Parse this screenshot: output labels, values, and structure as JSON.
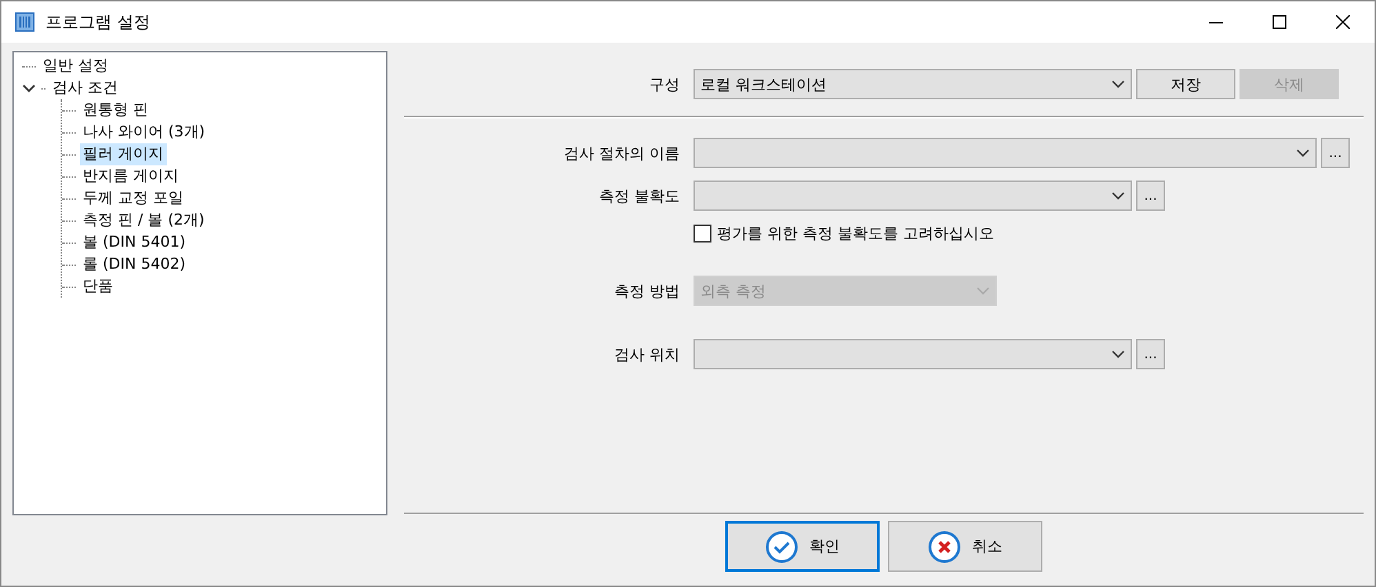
{
  "window": {
    "title": "프로그램 설정"
  },
  "tree": [
    {
      "label": "일반 설정",
      "selected": false
    },
    {
      "label": "검사 조건",
      "selected": false,
      "expanded": true,
      "children": [
        {
          "label": "원통형 핀",
          "selected": false
        },
        {
          "label": "나사 와이어 (3개)",
          "selected": false
        },
        {
          "label": "필러 게이지",
          "selected": true
        },
        {
          "label": "반지름 게이지",
          "selected": false
        },
        {
          "label": "두께 교정 포일",
          "selected": false
        },
        {
          "label": "측정 핀 / 볼 (2개)",
          "selected": false
        },
        {
          "label": "볼 (DIN 5401)",
          "selected": false
        },
        {
          "label": "롤 (DIN 5402)",
          "selected": false
        },
        {
          "label": "단품",
          "selected": false
        }
      ]
    }
  ],
  "configuration": {
    "label": "구성",
    "value": "로컬 워크스테이션",
    "buttons": [
      {
        "label": "저장",
        "disabled": false
      },
      {
        "label": "삭제",
        "disabled": true
      }
    ]
  },
  "groups": [
    [
      {
        "kind": "long-combo",
        "label": "검사 절차의 이름",
        "browse": "...",
        "disabled": false
      },
      {
        "kind": "combo",
        "label": "측정 불확도",
        "browse": "...",
        "disabled": false
      },
      {
        "kind": "checkbox",
        "label": "평가를 위한 측정 불확도를 고려하십시오",
        "checked": false
      }
    ],
    [
      {
        "kind": "short-combo",
        "label": "측정 방법",
        "value": "외측 측정",
        "disabled": true
      }
    ],
    [
      {
        "kind": "combo",
        "label": "검사 위치",
        "browse": "...",
        "disabled": false
      }
    ]
  ],
  "dialog_buttons": [
    {
      "label": "확인",
      "kind": "ok",
      "default": true
    },
    {
      "label": "취소",
      "kind": "cancel",
      "default": false
    }
  ]
}
